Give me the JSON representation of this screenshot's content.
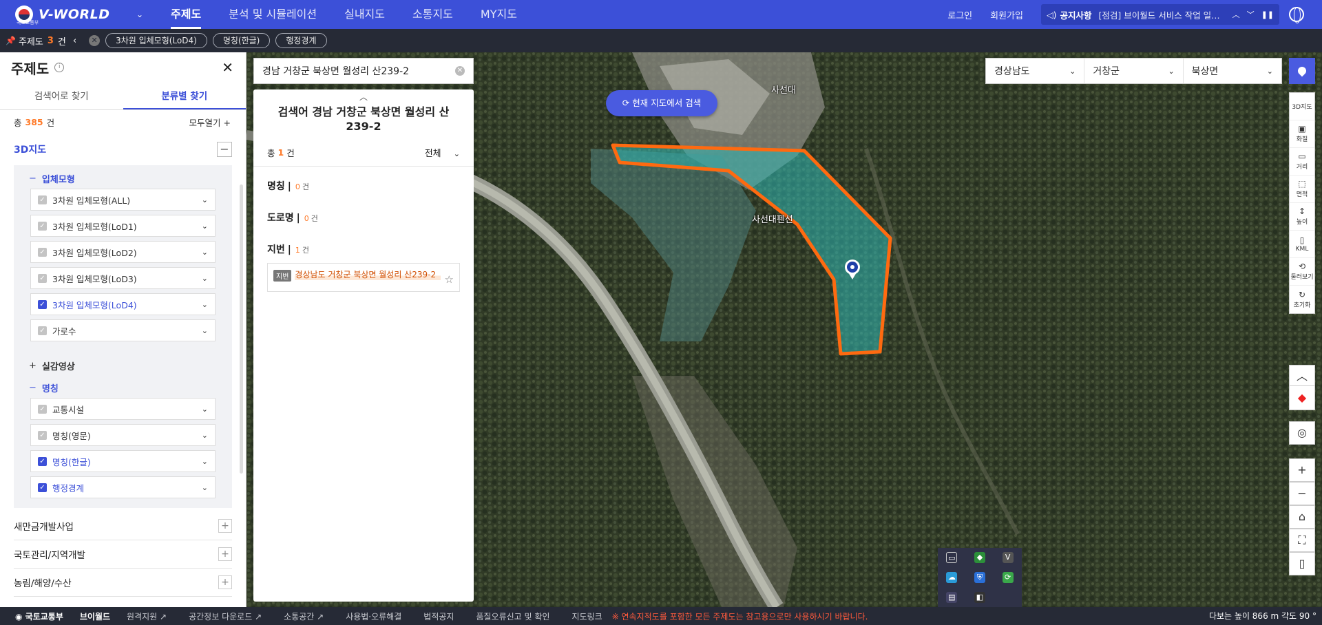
{
  "header": {
    "brand": "V-WORLD",
    "ministry": "국토교통부",
    "menu": [
      {
        "label": "주제도",
        "active": true
      },
      {
        "label": "분석 및 시뮬레이션",
        "active": false
      },
      {
        "label": "실내지도",
        "active": false
      },
      {
        "label": "소통지도",
        "active": false
      },
      {
        "label": "MY지도",
        "active": false
      }
    ],
    "login": "로그인",
    "signup": "회원가입",
    "notice_label": "공지사항",
    "notice_text": "[점검] 브이월드 서비스 작업 일정 ···"
  },
  "subbar": {
    "title": "주제도",
    "count": "3",
    "unit": "건",
    "chips": [
      "3차원 입체모형(LoD4)",
      "명칭(한글)",
      "행정경계"
    ]
  },
  "left_panel": {
    "title": "주제도",
    "tabs": [
      {
        "label": "검색어로 찾기",
        "active": false
      },
      {
        "label": "분류별 찾기",
        "active": true
      }
    ],
    "total_prefix": "총",
    "total": "385",
    "total_unit": "건",
    "open_all": "모두열기 +",
    "section": "3D지도",
    "groups": [
      {
        "name": "입체모형",
        "expanded": true,
        "layers": [
          {
            "label": "3차원 입체모형(ALL)",
            "on": false
          },
          {
            "label": "3차원 입체모형(LoD1)",
            "on": false
          },
          {
            "label": "3차원 입체모형(LoD2)",
            "on": false
          },
          {
            "label": "3차원 입체모형(LoD3)",
            "on": false
          },
          {
            "label": "3차원 입체모형(LoD4)",
            "on": true
          },
          {
            "label": "가로수",
            "on": false
          }
        ]
      },
      {
        "name": "실감영상",
        "expanded": false,
        "layers": []
      },
      {
        "name": "명칭",
        "expanded": true,
        "layers": [
          {
            "label": "교통시설",
            "on": false
          },
          {
            "label": "명칭(영문)",
            "on": false
          },
          {
            "label": "명칭(한글)",
            "on": true
          },
          {
            "label": "행정경계",
            "on": true
          }
        ]
      }
    ],
    "categories": [
      "새만금개발사업",
      "국토관리/지역개발",
      "농림/해양/수산"
    ]
  },
  "search": {
    "value": "경남 거창군 북상면 월성리 산239-2",
    "result_title": "검색어 경남 거창군 북상면 월성리 산239-2",
    "total_prefix": "총",
    "total": "1",
    "total_unit": "건",
    "filter": "전체",
    "sections": [
      {
        "name": "명칭",
        "count": "0",
        "unit": "건"
      },
      {
        "name": "도로명",
        "count": "0",
        "unit": "건"
      },
      {
        "name": "지번",
        "count": "1",
        "unit": "건"
      }
    ],
    "result_item": {
      "badge": "지번",
      "address": "경상남도 거창군 북상면 월성리 산239-2"
    }
  },
  "map": {
    "search_here": "현재 지도에서 검색",
    "regions": [
      "경상남도",
      "거창군",
      "북상면"
    ],
    "labels": [
      "사선대",
      "사선대펜션"
    ],
    "tools": [
      {
        "icon": "cube-icon",
        "label": "3D지도"
      },
      {
        "icon": "screenshot-icon",
        "label": "화질"
      },
      {
        "icon": "ruler-icon",
        "label": "거리"
      },
      {
        "icon": "area-icon",
        "label": "면적"
      },
      {
        "icon": "height-icon",
        "label": "높이"
      },
      {
        "icon": "kml-icon",
        "label": "KML"
      },
      {
        "icon": "rotate-icon",
        "label": "둘러보기"
      },
      {
        "icon": "reset-icon",
        "label": "초기화"
      }
    ],
    "accent": "#4a5be0",
    "boundary_color": "#ff6a10"
  },
  "footer": {
    "items": [
      "국토교통부",
      "브이월드",
      "원격지원",
      "공간정보 다운로드",
      "소통공간",
      "사용법·오류해결",
      "법적공지",
      "품질오류신고 및 확인",
      "지도링크"
    ],
    "warning": "※ 연속지적도를 포함한 모든 주제도는 참고용으로만 사용하시기 바랍니다.",
    "status": "다보는 높이 866 m   각도 90 °"
  }
}
